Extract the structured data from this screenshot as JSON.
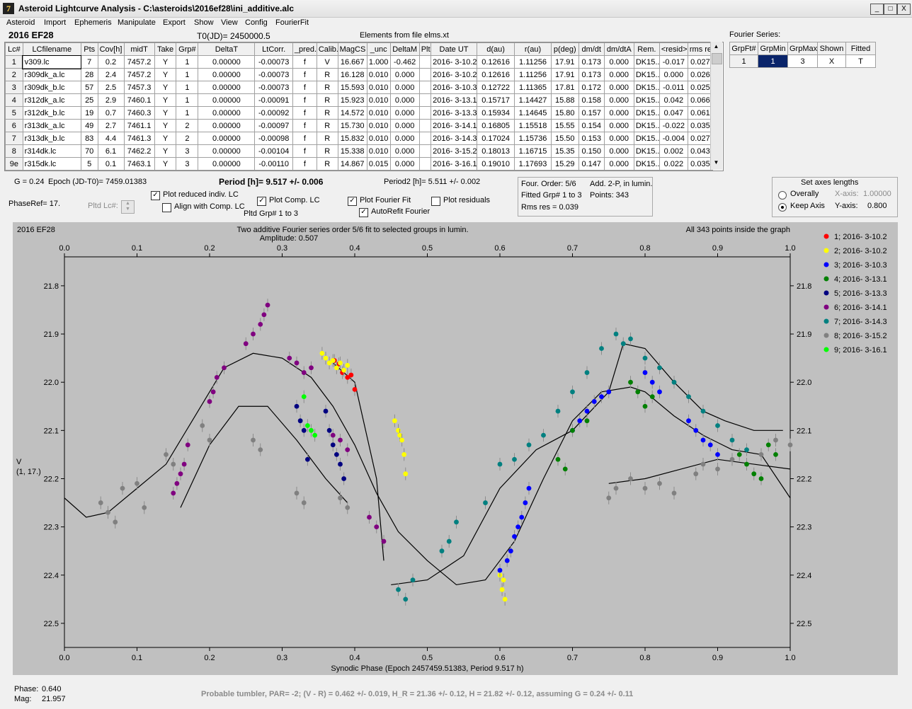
{
  "window": {
    "title": "Asteroid Lightcurve Analysis - C:\\asteroids\\2016ef28\\ini_additive.alc",
    "min": "_",
    "max": "□",
    "close": "X"
  },
  "menu": [
    "Asteroid",
    "Import",
    "Ephemeris",
    "Manipulate",
    "Export",
    "Show",
    "View",
    "Config",
    "FourierFit"
  ],
  "header": {
    "object": "2016 EF28",
    "t0": "T0(JD)= 2450000.5",
    "elements": "Elements from file elms.xt"
  },
  "table": {
    "columns": [
      "Lc#",
      "LCfilename",
      "Pts",
      "Cov[h]",
      "midT",
      "Take",
      "Grp#",
      "DeltaT",
      "LtCorr.",
      "_pred.",
      "Calib.",
      "MagCS",
      "_unc",
      "DeltaM",
      "Plt",
      "Date UT",
      "d(au)",
      "r(au)",
      "p(deg)",
      "dm/dt",
      "dm/dtA",
      "Rem.",
      "<resid>",
      "rms res"
    ],
    "rows": [
      [
        "1",
        "v309.lc",
        "7",
        "0.2",
        "7457.2",
        "Y",
        "1",
        "0.00000",
        "-0.00073",
        "f",
        "V",
        "16.667",
        "1.000",
        "-0.462",
        "",
        "2016- 3-10.2",
        "0.12616",
        "1.11256",
        "17.91",
        "0.173",
        "0.000",
        "DK15...",
        "-0.017",
        "0.027"
      ],
      [
        "2",
        "r309dk_a.lc",
        "28",
        "2.4",
        "7457.2",
        "Y",
        "1",
        "0.00000",
        "-0.00073",
        "f",
        "R",
        "16.128",
        "0.010",
        "0.000",
        "",
        "2016- 3-10.2",
        "0.12616",
        "1.11256",
        "17.91",
        "0.173",
        "0.000",
        "DK15...",
        "0.000",
        "0.026"
      ],
      [
        "3",
        "r309dk_b.lc",
        "57",
        "2.5",
        "7457.3",
        "Y",
        "1",
        "0.00000",
        "-0.00073",
        "f",
        "R",
        "15.593",
        "0.010",
        "0.000",
        "",
        "2016- 3-10.3",
        "0.12722",
        "1.11365",
        "17.81",
        "0.172",
        "0.000",
        "DK15...",
        "-0.011",
        "0.025"
      ],
      [
        "4",
        "r312dk_a.lc",
        "25",
        "2.9",
        "7460.1",
        "Y",
        "1",
        "0.00000",
        "-0.00091",
        "f",
        "R",
        "15.923",
        "0.010",
        "0.000",
        "",
        "2016- 3-13.1",
        "0.15717",
        "1.14427",
        "15.88",
        "0.158",
        "0.000",
        "DK15...",
        "0.042",
        "0.066"
      ],
      [
        "5",
        "r312dk_b.lc",
        "19",
        "0.7",
        "7460.3",
        "Y",
        "1",
        "0.00000",
        "-0.00092",
        "f",
        "R",
        "14.572",
        "0.010",
        "0.000",
        "",
        "2016- 3-13.3",
        "0.15934",
        "1.14645",
        "15.80",
        "0.157",
        "0.000",
        "DK15...",
        "0.047",
        "0.061"
      ],
      [
        "6",
        "r313dk_a.lc",
        "49",
        "2.7",
        "7461.1",
        "Y",
        "2",
        "0.00000",
        "-0.00097",
        "f",
        "R",
        "15.730",
        "0.010",
        "0.000",
        "",
        "2016- 3-14.1",
        "0.16805",
        "1.15518",
        "15.55",
        "0.154",
        "0.000",
        "DK15...",
        "-0.022",
        "0.035"
      ],
      [
        "7",
        "r313dk_b.lc",
        "83",
        "4.4",
        "7461.3",
        "Y",
        "2",
        "0.00000",
        "-0.00098",
        "f",
        "R",
        "15.832",
        "0.010",
        "0.000",
        "",
        "2016- 3-14.3",
        "0.17024",
        "1.15736",
        "15.50",
        "0.153",
        "0.000",
        "DK15...",
        "-0.004",
        "0.027"
      ],
      [
        "8",
        "r314dk.lc",
        "70",
        "6.1",
        "7462.2",
        "Y",
        "3",
        "0.00000",
        "-0.00104",
        "f",
        "R",
        "15.338",
        "0.010",
        "0.000",
        "",
        "2016- 3-15.2",
        "0.18013",
        "1.16715",
        "15.35",
        "0.150",
        "0.000",
        "DK15...",
        "0.002",
        "0.043"
      ],
      [
        "9e",
        "r315dk.lc",
        "5",
        "0.1",
        "7463.1",
        "Y",
        "3",
        "0.00000",
        "-0.00110",
        "f",
        "R",
        "14.867",
        "0.015",
        "0.000",
        "",
        "2016- 3-16.1",
        "0.19010",
        "1.17693",
        "15.29",
        "0.147",
        "0.000",
        "DK15...",
        "0.022",
        "0.035"
      ]
    ]
  },
  "fourier_series": {
    "label": "Fourier Series:",
    "columns": [
      "GrpFt#",
      "GrpMin",
      "GrpMax",
      "Shown",
      "Fitted"
    ],
    "row": [
      "1",
      "1",
      "3",
      "X",
      "T"
    ]
  },
  "info": {
    "g": "G = 0.24",
    "epoch": "Epoch (JD-T0)= 7459.01383",
    "period": "Period [h]= 9.517 +/- 0.006",
    "period2": "Period2 [h]= 5.511 +/- 0.002",
    "phaseref": "PhaseRef= 17.",
    "pltd_lc": "Pltd Lc#:",
    "pltd_grp": "Pltd Grp#  1   to   3",
    "four_order": "Four. Order:  5/6",
    "add2p": "Add. 2-P, in lumin.",
    "fitted_grp": "Fitted Grp# 1 to 3",
    "points": "Points: 343",
    "rms": "Rms res     = 0.039"
  },
  "checkboxes": [
    {
      "label": "Plot reduced indiv. LC",
      "checked": true
    },
    {
      "label": "Align with Comp. LC",
      "checked": false
    },
    {
      "label": "Plot Comp. LC",
      "checked": true
    },
    {
      "label": "Plot Fourier Fit",
      "checked": true
    },
    {
      "label": "Plot residuals",
      "checked": false
    },
    {
      "label": "AutoRefit Fourier",
      "checked": true
    }
  ],
  "axes_box": {
    "title": "Set axes lengths",
    "overally": "Overally",
    "keep": "Keep Axis",
    "xaxis_label": "X-axis:",
    "xaxis_value": "1.00000",
    "yaxis_label": "Y-axis:",
    "yaxis_value": "0.800"
  },
  "chart_data": {
    "type": "scatter",
    "title": "Two additive Fourier series order 5/6 fit to selected groups in lumin.",
    "subtitle": "Amplitude: 0.507",
    "object_label": "2016 EF28",
    "inside_note": "All 343 points inside the graph",
    "xlabel": "Synodic Phase (Epoch 2457459.51383, Period 9.517 h)",
    "ylabel": "V",
    "ylabel2": "(1, 17.)",
    "xlim": [
      0,
      1
    ],
    "ylim": [
      22.55,
      21.74
    ],
    "xticks": [
      "0.0",
      "0.1",
      "0.2",
      "0.3",
      "0.4",
      "0.5",
      "0.6",
      "0.7",
      "0.8",
      "0.9",
      "1.0"
    ],
    "yticks": [
      "21.8",
      "21.9",
      "22.0",
      "22.1",
      "22.2",
      "22.3",
      "22.4",
      "22.5"
    ],
    "series": [
      {
        "name": "1; 2016- 3-10.2",
        "color": "#ff0000",
        "x": [
          0.372,
          0.378,
          0.383,
          0.39,
          0.395,
          0.4
        ],
        "y": [
          21.955,
          21.962,
          21.98,
          21.99,
          21.985,
          22.015
        ]
      },
      {
        "name": "2; 2016- 3-10.2",
        "color": "#ffff00",
        "x": [
          0.355,
          0.36,
          0.365,
          0.37,
          0.375,
          0.38,
          0.385,
          0.39,
          0.455,
          0.46,
          0.462,
          0.465,
          0.468,
          0.47,
          0.6,
          0.603,
          0.605,
          0.607
        ],
        "y": [
          21.94,
          21.95,
          21.96,
          21.955,
          21.97,
          21.96,
          21.975,
          21.965,
          22.08,
          22.1,
          22.11,
          22.12,
          22.15,
          22.19,
          22.4,
          22.43,
          22.41,
          22.45
        ]
      },
      {
        "name": "3; 2016- 3-10.3",
        "color": "#0000ff",
        "x": [
          0.6,
          0.61,
          0.615,
          0.62,
          0.625,
          0.63,
          0.635,
          0.64,
          0.7,
          0.71,
          0.72,
          0.73,
          0.74,
          0.75,
          0.8,
          0.81,
          0.82,
          0.86,
          0.87,
          0.88,
          0.89,
          0.9
        ],
        "y": [
          22.39,
          22.37,
          22.35,
          22.32,
          22.3,
          22.28,
          22.25,
          22.22,
          22.1,
          22.08,
          22.06,
          22.04,
          22.03,
          22.02,
          21.98,
          22.0,
          22.02,
          22.08,
          22.1,
          22.12,
          22.13,
          22.15
        ]
      },
      {
        "name": "4; 2016- 3-13.1",
        "color": "#008000",
        "x": [
          0.68,
          0.69,
          0.7,
          0.72,
          0.78,
          0.79,
          0.8,
          0.81,
          0.93,
          0.94,
          0.95,
          0.96,
          0.97,
          0.98
        ],
        "y": [
          22.16,
          22.18,
          22.1,
          22.08,
          22.0,
          22.02,
          22.05,
          22.03,
          22.15,
          22.17,
          22.19,
          22.2,
          22.13,
          22.15
        ]
      },
      {
        "name": "5; 2016- 3-13.3",
        "color": "#000080",
        "x": [
          0.32,
          0.325,
          0.33,
          0.335,
          0.36,
          0.365,
          0.37,
          0.375,
          0.38,
          0.385
        ],
        "y": [
          22.05,
          22.08,
          22.1,
          22.16,
          22.06,
          22.1,
          22.13,
          22.15,
          22.17,
          22.2
        ]
      },
      {
        "name": "6; 2016- 3-14.1",
        "color": "#800080",
        "x": [
          0.15,
          0.155,
          0.16,
          0.165,
          0.17,
          0.2,
          0.205,
          0.21,
          0.22,
          0.25,
          0.26,
          0.27,
          0.275,
          0.28,
          0.31,
          0.32,
          0.33,
          0.34,
          0.37,
          0.38,
          0.39,
          0.42,
          0.43,
          0.44
        ],
        "y": [
          22.23,
          22.21,
          22.19,
          22.17,
          22.13,
          22.04,
          22.02,
          21.99,
          21.97,
          21.92,
          21.9,
          21.88,
          21.86,
          21.84,
          21.95,
          21.96,
          21.98,
          21.97,
          22.11,
          22.12,
          22.14,
          22.28,
          22.3,
          22.33
        ]
      },
      {
        "name": "7; 2016- 3-14.3",
        "color": "#008080",
        "x": [
          0.46,
          0.47,
          0.48,
          0.52,
          0.53,
          0.54,
          0.58,
          0.6,
          0.62,
          0.64,
          0.66,
          0.68,
          0.7,
          0.72,
          0.74,
          0.76,
          0.77,
          0.78,
          0.8,
          0.82,
          0.84,
          0.86,
          0.88,
          0.9,
          0.92,
          0.94
        ],
        "y": [
          22.43,
          22.45,
          22.41,
          22.35,
          22.33,
          22.29,
          22.25,
          22.17,
          22.16,
          22.13,
          22.11,
          22.06,
          22.02,
          21.98,
          21.93,
          21.9,
          21.92,
          21.91,
          21.95,
          21.97,
          22.0,
          22.03,
          22.06,
          22.09,
          22.12,
          22.14
        ]
      },
      {
        "name": "8; 2016- 3-15.2",
        "color": "#808080",
        "x": [
          0.05,
          0.06,
          0.07,
          0.08,
          0.1,
          0.11,
          0.14,
          0.15,
          0.19,
          0.2,
          0.26,
          0.27,
          0.32,
          0.33,
          0.38,
          0.39,
          0.75,
          0.76,
          0.78,
          0.8,
          0.82,
          0.84,
          0.87,
          0.88,
          0.9,
          0.92,
          0.96,
          0.98,
          1.0
        ],
        "y": [
          22.25,
          22.27,
          22.29,
          22.22,
          22.21,
          22.26,
          22.15,
          22.17,
          22.09,
          22.12,
          22.12,
          22.14,
          22.23,
          22.25,
          22.24,
          22.26,
          22.24,
          22.22,
          22.2,
          22.22,
          22.21,
          22.23,
          22.19,
          22.17,
          22.18,
          22.16,
          22.15,
          22.12,
          22.13
        ]
      },
      {
        "name": "9; 2016- 3-16.1",
        "color": "#00ff00",
        "x": [
          0.33,
          0.335,
          0.34,
          0.345
        ],
        "y": [
          22.03,
          22.09,
          22.1,
          22.11
        ]
      }
    ],
    "fit_curves_note": "Fourier fit curves drawn as black lines"
  },
  "status": {
    "phase_label": "Phase:",
    "phase": "0.640",
    "mag_label": "Mag:",
    "mag": "21.957",
    "footer": "Probable tumbler, PAR= -2; (V - R) = 0.462 +/- 0.019, H_R = 21.36 +/- 0.12, H = 21.82 +/- 0.12, assuming G = 0.24 +/- 0.11"
  }
}
